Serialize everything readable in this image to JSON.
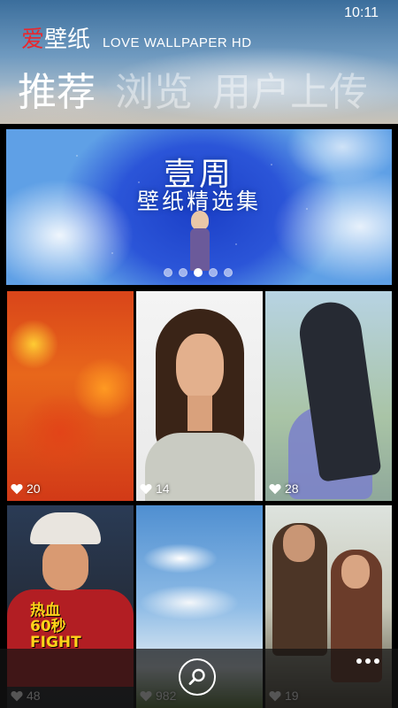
{
  "status": {
    "time": "10:11"
  },
  "app": {
    "brand_love": "爱",
    "brand_name": "壁纸",
    "brand_en": "LOVE WALLPAPER HD"
  },
  "pivot": {
    "items": [
      {
        "label": "推荐",
        "active": true
      },
      {
        "label": "浏览",
        "active": false
      },
      {
        "label": "用户上传",
        "active": false
      }
    ]
  },
  "banner": {
    "title": "壹周",
    "subtitle": "壁纸精选集",
    "page_count": 5,
    "active_page": 3
  },
  "tiles": [
    {
      "likes": "20"
    },
    {
      "likes": "14"
    },
    {
      "likes": "28"
    },
    {
      "likes": "48",
      "overlay_text": "热血\n60秒\nFIGHT"
    },
    {
      "likes": "982"
    },
    {
      "likes": "19"
    }
  ],
  "appbar": {
    "search_icon": "search-icon",
    "more_icon": "more-icon"
  },
  "colors": {
    "brand_red": "#e8282e",
    "background": "#000000"
  }
}
